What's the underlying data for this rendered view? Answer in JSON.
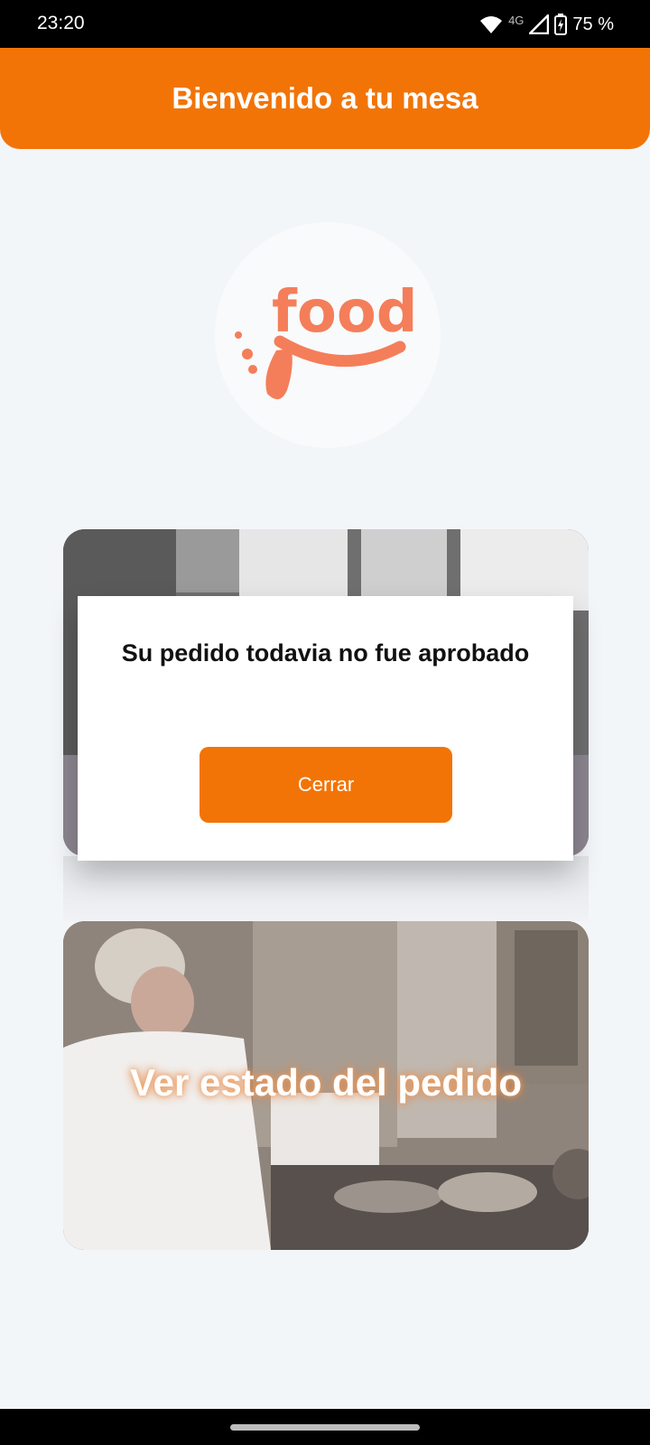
{
  "status_bar": {
    "time": "23:20",
    "network": "4G",
    "battery": "75 %",
    "icons": [
      "wifi-icon",
      "signal-icon",
      "battery-charging-icon"
    ]
  },
  "header": {
    "title": "Bienvenido a tu mesa"
  },
  "logo": {
    "text": "food",
    "color": "#f47e5a"
  },
  "cards": [
    {
      "title": ""
    },
    {
      "title": "Ver estado del pedido"
    }
  ],
  "dialog": {
    "message": "Su pedido todavia no fue aprobado",
    "close_label": "Cerrar"
  },
  "colors": {
    "accent": "#f27407",
    "background": "#f3f6f9"
  }
}
